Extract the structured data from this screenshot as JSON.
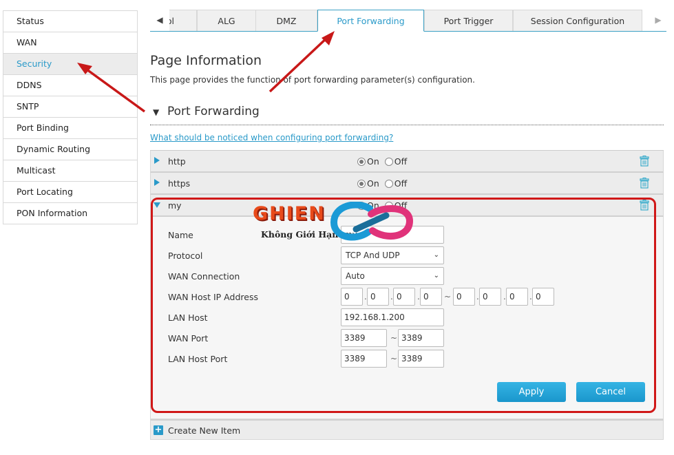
{
  "sidebar": {
    "items": [
      {
        "label": "Status",
        "active": false
      },
      {
        "label": "WAN",
        "active": false
      },
      {
        "label": "Security",
        "active": true
      },
      {
        "label": "DDNS",
        "active": false
      },
      {
        "label": "SNTP",
        "active": false
      },
      {
        "label": "Port Binding",
        "active": false
      },
      {
        "label": "Dynamic Routing",
        "active": false
      },
      {
        "label": "Multicast",
        "active": false
      },
      {
        "label": "Port Locating",
        "active": false
      },
      {
        "label": "PON Information",
        "active": false
      }
    ]
  },
  "tabs": {
    "prev_icon": "◀",
    "next_icon": "▶",
    "items": [
      {
        "label": "ol",
        "active": false
      },
      {
        "label": "ALG",
        "active": false
      },
      {
        "label": "DMZ",
        "active": false
      },
      {
        "label": "Port Forwarding",
        "active": true
      },
      {
        "label": "Port Trigger",
        "active": false
      },
      {
        "label": "Session Configuration",
        "active": false
      }
    ]
  },
  "page": {
    "title": "Page Information",
    "description": "This page provides the function of port forwarding parameter(s) configuration."
  },
  "section": {
    "title": "Port Forwarding",
    "collapse_icon": "▼",
    "help_link": "What should be noticed when configuring port forwarding?"
  },
  "rules": [
    {
      "name": "http",
      "on_label": "On",
      "off_label": "Off",
      "state": "on",
      "expanded": false
    },
    {
      "name": "https",
      "on_label": "On",
      "off_label": "Off",
      "state": "on",
      "expanded": false
    },
    {
      "name": "my",
      "on_label": "On",
      "off_label": "Off",
      "state": "on",
      "expanded": true
    }
  ],
  "form": {
    "name_label": "Name",
    "name_value": "my",
    "protocol_label": "Protocol",
    "protocol_value": "TCP And UDP",
    "wan_connection_label": "WAN Connection",
    "wan_connection_value": "Auto",
    "wan_host_ip_label": "WAN Host IP Address",
    "wan_host_ip_start": [
      "0",
      "0",
      "0",
      "0"
    ],
    "wan_host_ip_end": [
      "0",
      "0",
      "0",
      "0"
    ],
    "lan_host_label": "LAN Host",
    "lan_host_value": "192.168.1.200",
    "wan_port_label": "WAN Port",
    "wan_port_start": "3389",
    "wan_port_end": "3389",
    "lan_host_port_label": "LAN Host Port",
    "lan_host_port_start": "3389",
    "lan_host_port_end": "3389",
    "dot": ".",
    "tilde": "~",
    "apply_label": "Apply",
    "cancel_label": "Cancel"
  },
  "create_item": {
    "label": "Create New Item",
    "icon": "+"
  },
  "watermark": {
    "brand": "GHIEN",
    "tagline": "Không Giới Hạn"
  },
  "colors": {
    "accent": "#2a9ac9",
    "button": "#1fa3d8",
    "annotation": "#d01818"
  }
}
